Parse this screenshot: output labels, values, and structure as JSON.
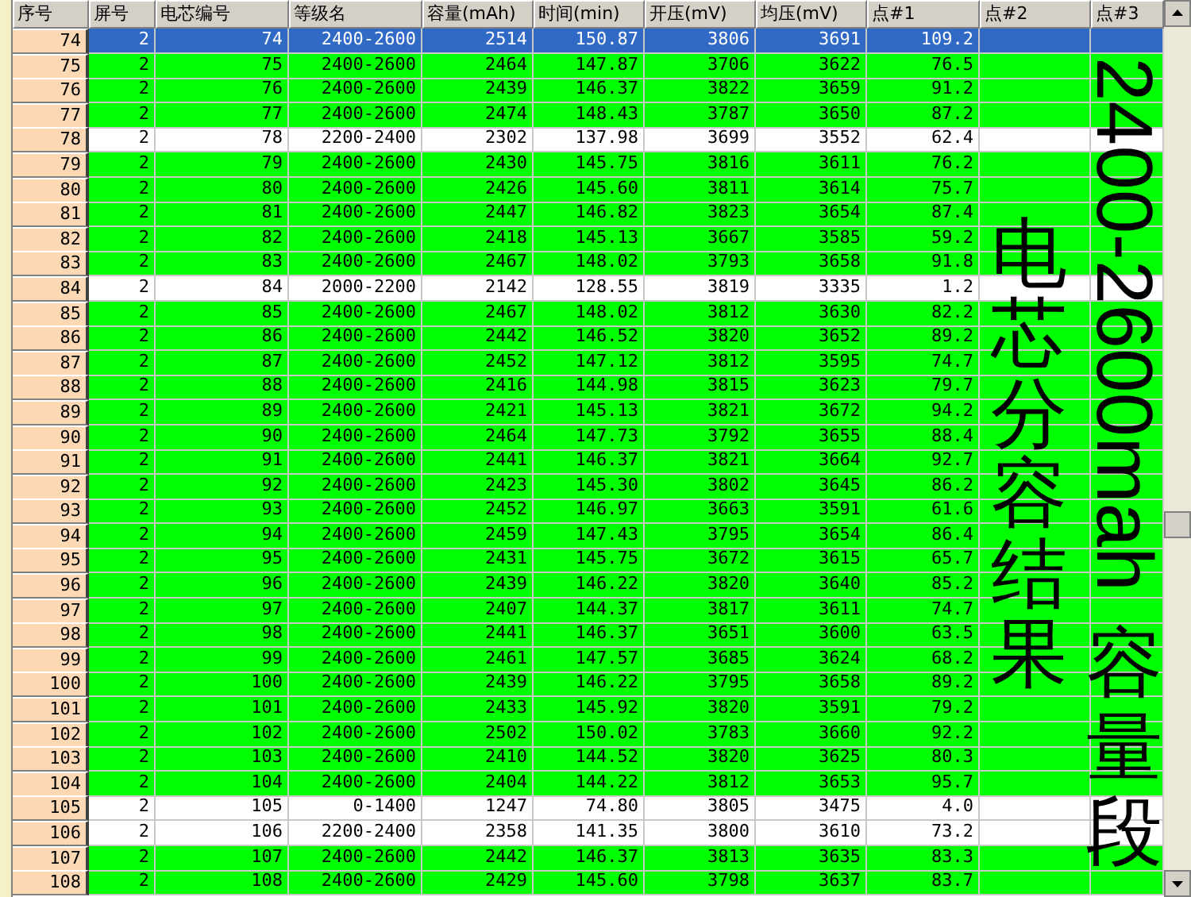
{
  "table": {
    "columns": [
      "序号",
      "屏号",
      "电芯编号",
      "等级名",
      "容量(mAh)",
      "时间(min)",
      "开压(mV)",
      "均压(mV)",
      "点#1",
      "点#2",
      "点#3"
    ],
    "rows": [
      {
        "cells": [
          "74",
          "2",
          "74",
          "2400-2600",
          "2514",
          "150.87",
          "3806",
          "3691",
          "109.2"
        ],
        "color": "#316ac5",
        "selected": true
      },
      {
        "cells": [
          "75",
          "2",
          "75",
          "2400-2600",
          "2464",
          "147.87",
          "3706",
          "3622",
          "76.5"
        ],
        "color": "#00ff00",
        "selected": false
      },
      {
        "cells": [
          "76",
          "2",
          "76",
          "2400-2600",
          "2439",
          "146.37",
          "3822",
          "3659",
          "91.2"
        ],
        "color": "#00ff00",
        "selected": false
      },
      {
        "cells": [
          "77",
          "2",
          "77",
          "2400-2600",
          "2474",
          "148.43",
          "3787",
          "3650",
          "87.2"
        ],
        "color": "#00ff00",
        "selected": false
      },
      {
        "cells": [
          "78",
          "2",
          "78",
          "2200-2400",
          "2302",
          "137.98",
          "3699",
          "3552",
          "62.4"
        ],
        "color": "#ffffff",
        "selected": false
      },
      {
        "cells": [
          "79",
          "2",
          "79",
          "2400-2600",
          "2430",
          "145.75",
          "3816",
          "3611",
          "76.2"
        ],
        "color": "#00ff00",
        "selected": false
      },
      {
        "cells": [
          "80",
          "2",
          "80",
          "2400-2600",
          "2426",
          "145.60",
          "3811",
          "3614",
          "75.7"
        ],
        "color": "#00ff00",
        "selected": false
      },
      {
        "cells": [
          "81",
          "2",
          "81",
          "2400-2600",
          "2447",
          "146.82",
          "3823",
          "3654",
          "87.4"
        ],
        "color": "#00ff00",
        "selected": false
      },
      {
        "cells": [
          "82",
          "2",
          "82",
          "2400-2600",
          "2418",
          "145.13",
          "3667",
          "3585",
          "59.2"
        ],
        "color": "#00ff00",
        "selected": false
      },
      {
        "cells": [
          "83",
          "2",
          "83",
          "2400-2600",
          "2467",
          "148.02",
          "3793",
          "3658",
          "91.8"
        ],
        "color": "#00ff00",
        "selected": false
      },
      {
        "cells": [
          "84",
          "2",
          "84",
          "2000-2200",
          "2142",
          "128.55",
          "3819",
          "3335",
          "1.2"
        ],
        "color": "#ffffff",
        "selected": false
      },
      {
        "cells": [
          "85",
          "2",
          "85",
          "2400-2600",
          "2467",
          "148.02",
          "3812",
          "3630",
          "82.2"
        ],
        "color": "#00ff00",
        "selected": false
      },
      {
        "cells": [
          "86",
          "2",
          "86",
          "2400-2600",
          "2442",
          "146.52",
          "3820",
          "3652",
          "89.2"
        ],
        "color": "#00ff00",
        "selected": false
      },
      {
        "cells": [
          "87",
          "2",
          "87",
          "2400-2600",
          "2452",
          "147.12",
          "3812",
          "3595",
          "74.7"
        ],
        "color": "#00ff00",
        "selected": false
      },
      {
        "cells": [
          "88",
          "2",
          "88",
          "2400-2600",
          "2416",
          "144.98",
          "3815",
          "3623",
          "79.7"
        ],
        "color": "#00ff00",
        "selected": false
      },
      {
        "cells": [
          "89",
          "2",
          "89",
          "2400-2600",
          "2421",
          "145.13",
          "3821",
          "3672",
          "94.2"
        ],
        "color": "#00ff00",
        "selected": false
      },
      {
        "cells": [
          "90",
          "2",
          "90",
          "2400-2600",
          "2464",
          "147.73",
          "3792",
          "3655",
          "88.4"
        ],
        "color": "#00ff00",
        "selected": false
      },
      {
        "cells": [
          "91",
          "2",
          "91",
          "2400-2600",
          "2441",
          "146.37",
          "3821",
          "3664",
          "92.7"
        ],
        "color": "#00ff00",
        "selected": false
      },
      {
        "cells": [
          "92",
          "2",
          "92",
          "2400-2600",
          "2423",
          "145.30",
          "3802",
          "3645",
          "86.2"
        ],
        "color": "#00ff00",
        "selected": false
      },
      {
        "cells": [
          "93",
          "2",
          "93",
          "2400-2600",
          "2452",
          "146.97",
          "3663",
          "3591",
          "61.6"
        ],
        "color": "#00ff00",
        "selected": false
      },
      {
        "cells": [
          "94",
          "2",
          "94",
          "2400-2600",
          "2459",
          "147.43",
          "3795",
          "3654",
          "86.4"
        ],
        "color": "#00ff00",
        "selected": false
      },
      {
        "cells": [
          "95",
          "2",
          "95",
          "2400-2600",
          "2431",
          "145.75",
          "3672",
          "3615",
          "65.7"
        ],
        "color": "#00ff00",
        "selected": false
      },
      {
        "cells": [
          "96",
          "2",
          "96",
          "2400-2600",
          "2439",
          "146.22",
          "3820",
          "3640",
          "85.2"
        ],
        "color": "#00ff00",
        "selected": false
      },
      {
        "cells": [
          "97",
          "2",
          "97",
          "2400-2600",
          "2407",
          "144.37",
          "3817",
          "3611",
          "74.7"
        ],
        "color": "#00ff00",
        "selected": false
      },
      {
        "cells": [
          "98",
          "2",
          "98",
          "2400-2600",
          "2441",
          "146.37",
          "3651",
          "3600",
          "63.5"
        ],
        "color": "#00ff00",
        "selected": false
      },
      {
        "cells": [
          "99",
          "2",
          "99",
          "2400-2600",
          "2461",
          "147.57",
          "3685",
          "3624",
          "68.2"
        ],
        "color": "#00ff00",
        "selected": false
      },
      {
        "cells": [
          "100",
          "2",
          "100",
          "2400-2600",
          "2439",
          "146.22",
          "3795",
          "3658",
          "89.2"
        ],
        "color": "#00ff00",
        "selected": false
      },
      {
        "cells": [
          "101",
          "2",
          "101",
          "2400-2600",
          "2433",
          "145.92",
          "3820",
          "3591",
          "79.2"
        ],
        "color": "#00ff00",
        "selected": false
      },
      {
        "cells": [
          "102",
          "2",
          "102",
          "2400-2600",
          "2502",
          "150.02",
          "3783",
          "3660",
          "92.2"
        ],
        "color": "#00ff00",
        "selected": false
      },
      {
        "cells": [
          "103",
          "2",
          "103",
          "2400-2600",
          "2410",
          "144.52",
          "3820",
          "3625",
          "80.3"
        ],
        "color": "#00ff00",
        "selected": false
      },
      {
        "cells": [
          "104",
          "2",
          "104",
          "2400-2600",
          "2404",
          "144.22",
          "3812",
          "3653",
          "95.7"
        ],
        "color": "#00ff00",
        "selected": false
      },
      {
        "cells": [
          "105",
          "2",
          "105",
          "0-1400",
          "1247",
          "74.80",
          "3805",
          "3475",
          "4.0"
        ],
        "color": "#ffffff",
        "selected": false
      },
      {
        "cells": [
          "106",
          "2",
          "106",
          "2200-2400",
          "2358",
          "141.35",
          "3800",
          "3610",
          "73.2"
        ],
        "color": "#ffffff",
        "selected": false
      },
      {
        "cells": [
          "107",
          "2",
          "107",
          "2400-2600",
          "2442",
          "146.37",
          "3813",
          "3635",
          "83.3"
        ],
        "color": "#00ff00",
        "selected": false
      },
      {
        "cells": [
          "108",
          "2",
          "108",
          "2400-2600",
          "2429",
          "145.60",
          "3798",
          "3637",
          "83.7"
        ],
        "color": "#00ff00",
        "selected": false
      }
    ]
  },
  "overlay": {
    "caption": "电芯分容结果",
    "band_range": "2400-2600mah",
    "band_unit": "容量段"
  }
}
